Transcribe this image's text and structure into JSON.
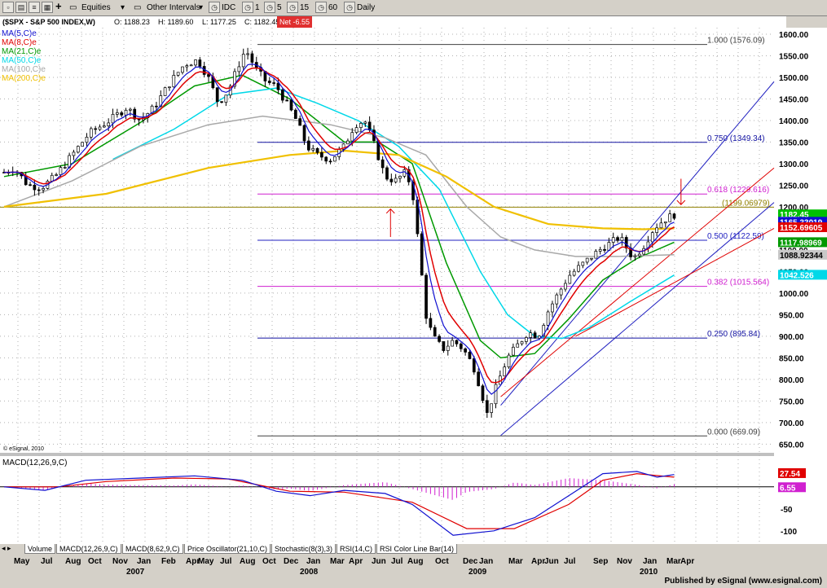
{
  "toolbar": {
    "symbol": "$SPX",
    "equities": "Equities",
    "other_intervals": "Other Intervals",
    "idc": "IDC",
    "intervals": [
      "1",
      "5",
      "15",
      "60",
      "Daily"
    ]
  },
  "chart_header": {
    "title": "($SPX - S&P 500 INDEX,W)",
    "open": "O: 1188.23",
    "high": "H: 1189.60",
    "low": "L: 1177.25",
    "close": "C: 1182.45",
    "net": "Net -6.55",
    "net_color": "#e03030"
  },
  "legend": [
    {
      "label": "MA(5,C)e",
      "color": "#1010d0"
    },
    {
      "label": "MA(8,C)e",
      "color": "#e00000"
    },
    {
      "label": "MA(21,C)e",
      "color": "#009900"
    },
    {
      "label": "MA(50,C)e",
      "color": "#00d8e8"
    },
    {
      "label": "MA(100,C)e",
      "color": "#a8a8a8"
    },
    {
      "label": "MA(200,C)e",
      "color": "#f0c000"
    }
  ],
  "copyright": "© eSignal, 2010",
  "fib_levels": [
    {
      "label": "1.000 (1576.09)",
      "value": 1576.09,
      "color": "#404040"
    },
    {
      "label": "0.750 (1349.34)",
      "value": 1349.34,
      "color": "#1010a0"
    },
    {
      "label": "0.618 (1229.616)",
      "value": 1229.616,
      "color": "#d020d0"
    },
    {
      "label": "(1199.06979)",
      "value": 1199.06979,
      "color": "#908000"
    },
    {
      "label": "0.500 (1122.59)",
      "value": 1122.59,
      "color": "#2020c0"
    },
    {
      "label": "0.382 (1015.564)",
      "value": 1015.564,
      "color": "#d020d0"
    },
    {
      "label": "0.250 (895.84)",
      "value": 895.84,
      "color": "#1010a0"
    },
    {
      "label": "0.000 (669.09)",
      "value": 669.09,
      "color": "#404040"
    }
  ],
  "price_tags": [
    {
      "label": "1182.45",
      "value": 1182.45,
      "bg": "#00c000",
      "fg": "#ffffff"
    },
    {
      "label": "1165.33019",
      "value": 1165.33019,
      "bg": "#1010d0",
      "fg": "#ffffff"
    },
    {
      "label": "1152.69605",
      "value": 1152.69605,
      "bg": "#e00000",
      "fg": "#ffffff"
    },
    {
      "label": "1117.98969",
      "value": 1117.98969,
      "bg": "#009900",
      "fg": "#ffffff"
    },
    {
      "label": "1088.92344",
      "value": 1088.92344,
      "bg": "#c8c8c8",
      "fg": "#000000"
    },
    {
      "label": "1042.526",
      "value": 1042.526,
      "bg": "#00d8e8",
      "fg": "#ffffff"
    }
  ],
  "macd_panel": {
    "title": "MACD(12,26,9,C)",
    "tags": [
      {
        "label": "27.54",
        "value": 27.54,
        "bg": "#e00000"
      },
      {
        "label": "6.55",
        "value": 6.55,
        "bg": "#d020d0"
      }
    ]
  },
  "tabs": [
    "Volume",
    "MACD(12,26,9,C)",
    "MACD(8,62,9,C)",
    "Price Oscillator(21,10,C)",
    "Stochastic(8(3),3)",
    "RSI(14,C)",
    "RSI Color Line Bar(14)"
  ],
  "footer": "Published by eSignal (www.esignal.com)",
  "chart_data": {
    "type": "candlestick",
    "title": "($SPX - S&P 500 INDEX,W)",
    "ylim": [
      630,
      1615
    ],
    "y_ticks": [
      650,
      700,
      750,
      800,
      850,
      900,
      950,
      1000,
      1050,
      1100,
      1150,
      1200,
      1250,
      1300,
      1350,
      1400,
      1450,
      1500,
      1550,
      1600
    ],
    "y_tick_labels": [
      "650.00",
      "700.00",
      "750.00",
      "800.00",
      "850.00",
      "900.00",
      "950.00",
      "1000.00",
      "1050.00",
      "1100.00",
      "1150.00",
      "1200.00",
      "1250.00",
      "1300.00",
      "1350.00",
      "1400.00",
      "1450.00",
      "1500.00",
      "1550.00",
      "1600.00"
    ],
    "x_months": [
      "May",
      "Jul",
      "Aug",
      "Oct",
      "Nov",
      "Jan",
      "Feb",
      "Apr",
      "May",
      "Jul",
      "Aug",
      "Oct",
      "Dec",
      "Jan",
      "Mar",
      "Apr",
      "Jun",
      "Jul",
      "Aug",
      "Oct",
      "Dec",
      "Jan",
      "Mar",
      "Apr",
      "Jun",
      "Jul",
      "Sep",
      "Nov",
      "Jan",
      "Mar",
      "Apr"
    ],
    "x_years": [
      "2007",
      "2008",
      "2009",
      "2010"
    ],
    "price_path": [
      {
        "t": 0,
        "v": 1280
      },
      {
        "t": 0.015,
        "v": 1290
      },
      {
        "t": 0.035,
        "v": 1250
      },
      {
        "t": 0.055,
        "v": 1245
      },
      {
        "t": 0.075,
        "v": 1270
      },
      {
        "t": 0.1,
        "v": 1320
      },
      {
        "t": 0.125,
        "v": 1370
      },
      {
        "t": 0.155,
        "v": 1400
      },
      {
        "t": 0.18,
        "v": 1430
      },
      {
        "t": 0.2,
        "v": 1400
      },
      {
        "t": 0.22,
        "v": 1430
      },
      {
        "t": 0.245,
        "v": 1490
      },
      {
        "t": 0.265,
        "v": 1530
      },
      {
        "t": 0.285,
        "v": 1540
      },
      {
        "t": 0.3,
        "v": 1500
      },
      {
        "t": 0.315,
        "v": 1440
      },
      {
        "t": 0.33,
        "v": 1470
      },
      {
        "t": 0.345,
        "v": 1530
      },
      {
        "t": 0.355,
        "v": 1565
      },
      {
        "t": 0.37,
        "v": 1520
      },
      {
        "t": 0.385,
        "v": 1490
      },
      {
        "t": 0.4,
        "v": 1480
      },
      {
        "t": 0.415,
        "v": 1440
      },
      {
        "t": 0.43,
        "v": 1400
      },
      {
        "t": 0.445,
        "v": 1340
      },
      {
        "t": 0.46,
        "v": 1320
      },
      {
        "t": 0.48,
        "v": 1310
      },
      {
        "t": 0.5,
        "v": 1340
      },
      {
        "t": 0.515,
        "v": 1390
      },
      {
        "t": 0.53,
        "v": 1400
      },
      {
        "t": 0.545,
        "v": 1340
      },
      {
        "t": 0.56,
        "v": 1270
      },
      {
        "t": 0.575,
        "v": 1260
      },
      {
        "t": 0.59,
        "v": 1280
      },
      {
        "t": 0.6,
        "v": 1240
      },
      {
        "t": 0.61,
        "v": 1100
      },
      {
        "t": 0.62,
        "v": 950
      },
      {
        "t": 0.63,
        "v": 900
      },
      {
        "t": 0.645,
        "v": 870
      },
      {
        "t": 0.66,
        "v": 890
      },
      {
        "t": 0.675,
        "v": 870
      },
      {
        "t": 0.69,
        "v": 830
      },
      {
        "t": 0.7,
        "v": 780
      },
      {
        "t": 0.71,
        "v": 720
      },
      {
        "t": 0.725,
        "v": 790
      },
      {
        "t": 0.74,
        "v": 850
      },
      {
        "t": 0.755,
        "v": 880
      },
      {
        "t": 0.77,
        "v": 910
      },
      {
        "t": 0.785,
        "v": 900
      },
      {
        "t": 0.8,
        "v": 960
      },
      {
        "t": 0.815,
        "v": 1000
      },
      {
        "t": 0.83,
        "v": 1040
      },
      {
        "t": 0.845,
        "v": 1060
      },
      {
        "t": 0.86,
        "v": 1080
      },
      {
        "t": 0.875,
        "v": 1100
      },
      {
        "t": 0.89,
        "v": 1115
      },
      {
        "t": 0.905,
        "v": 1130
      },
      {
        "t": 0.915,
        "v": 1105
      },
      {
        "t": 0.925,
        "v": 1080
      },
      {
        "t": 0.94,
        "v": 1110
      },
      {
        "t": 0.955,
        "v": 1150
      },
      {
        "t": 0.97,
        "v": 1170
      },
      {
        "t": 0.985,
        "v": 1182
      }
    ],
    "moving_averages": [
      {
        "name": "MA(21,C)e",
        "path": [
          {
            "t": 0,
            "v": 1270
          },
          {
            "t": 0.1,
            "v": 1300
          },
          {
            "t": 0.2,
            "v": 1395
          },
          {
            "t": 0.28,
            "v": 1480
          },
          {
            "t": 0.35,
            "v": 1505
          },
          {
            "t": 0.42,
            "v": 1450
          },
          {
            "t": 0.5,
            "v": 1350
          },
          {
            "t": 0.55,
            "v": 1350
          },
          {
            "t": 0.6,
            "v": 1300
          },
          {
            "t": 0.65,
            "v": 1070
          },
          {
            "t": 0.7,
            "v": 890
          },
          {
            "t": 0.73,
            "v": 850
          },
          {
            "t": 0.78,
            "v": 860
          },
          {
            "t": 0.83,
            "v": 940
          },
          {
            "t": 0.88,
            "v": 1030
          },
          {
            "t": 0.93,
            "v": 1080
          },
          {
            "t": 0.985,
            "v": 1118
          }
        ]
      },
      {
        "name": "MA(50,C)e",
        "path": [
          {
            "t": 0.16,
            "v": 1310
          },
          {
            "t": 0.25,
            "v": 1380
          },
          {
            "t": 0.33,
            "v": 1460
          },
          {
            "t": 0.4,
            "v": 1475
          },
          {
            "t": 0.46,
            "v": 1440
          },
          {
            "t": 0.52,
            "v": 1400
          },
          {
            "t": 0.58,
            "v": 1340
          },
          {
            "t": 0.64,
            "v": 1240
          },
          {
            "t": 0.7,
            "v": 1050
          },
          {
            "t": 0.74,
            "v": 950
          },
          {
            "t": 0.78,
            "v": 900
          },
          {
            "t": 0.82,
            "v": 895
          },
          {
            "t": 0.86,
            "v": 920
          },
          {
            "t": 0.92,
            "v": 980
          },
          {
            "t": 0.985,
            "v": 1042
          }
        ]
      },
      {
        "name": "MA(100,C)e",
        "path": [
          {
            "t": 0,
            "v": 1200
          },
          {
            "t": 0.1,
            "v": 1260
          },
          {
            "t": 0.2,
            "v": 1340
          },
          {
            "t": 0.3,
            "v": 1390
          },
          {
            "t": 0.38,
            "v": 1410
          },
          {
            "t": 0.48,
            "v": 1390
          },
          {
            "t": 0.56,
            "v": 1360
          },
          {
            "t": 0.62,
            "v": 1320
          },
          {
            "t": 0.68,
            "v": 1200
          },
          {
            "t": 0.73,
            "v": 1130
          },
          {
            "t": 0.78,
            "v": 1100
          },
          {
            "t": 0.84,
            "v": 1085
          },
          {
            "t": 0.9,
            "v": 1085
          },
          {
            "t": 0.985,
            "v": 1089
          }
        ]
      },
      {
        "name": "MA(200,C)e",
        "path": [
          {
            "t": 0,
            "v": 1200
          },
          {
            "t": 0.15,
            "v": 1230
          },
          {
            "t": 0.3,
            "v": 1290
          },
          {
            "t": 0.42,
            "v": 1320
          },
          {
            "t": 0.5,
            "v": 1330
          },
          {
            "t": 0.58,
            "v": 1320
          },
          {
            "t": 0.65,
            "v": 1270
          },
          {
            "t": 0.72,
            "v": 1200
          },
          {
            "t": 0.8,
            "v": 1160
          },
          {
            "t": 0.88,
            "v": 1150
          },
          {
            "t": 0.94,
            "v": 1148
          },
          {
            "t": 0.985,
            "v": 1150
          }
        ]
      }
    ],
    "macd": {
      "ylim": [
        -130,
        70
      ],
      "y_ticks": [
        -100,
        -50
      ],
      "y_tick_labels": [
        "-100",
        "-50"
      ],
      "macd_line": [
        {
          "t": 0,
          "v": 0
        },
        {
          "t": 0.06,
          "v": -8
        },
        {
          "t": 0.12,
          "v": 15
        },
        {
          "t": 0.2,
          "v": 20
        },
        {
          "t": 0.28,
          "v": 25
        },
        {
          "t": 0.35,
          "v": 15
        },
        {
          "t": 0.4,
          "v": -10
        },
        {
          "t": 0.45,
          "v": -20
        },
        {
          "t": 0.5,
          "v": -8
        },
        {
          "t": 0.56,
          "v": -15
        },
        {
          "t": 0.6,
          "v": -40
        },
        {
          "t": 0.66,
          "v": -110
        },
        {
          "t": 0.72,
          "v": -100
        },
        {
          "t": 0.78,
          "v": -70
        },
        {
          "t": 0.84,
          "v": -10
        },
        {
          "t": 0.88,
          "v": 30
        },
        {
          "t": 0.93,
          "v": 35
        },
        {
          "t": 0.96,
          "v": 22
        },
        {
          "t": 0.985,
          "v": 28
        }
      ],
      "signal_line": [
        {
          "t": 0,
          "v": 0
        },
        {
          "t": 0.08,
          "v": 0
        },
        {
          "t": 0.15,
          "v": 12
        },
        {
          "t": 0.25,
          "v": 20
        },
        {
          "t": 0.33,
          "v": 18
        },
        {
          "t": 0.42,
          "v": -10
        },
        {
          "t": 0.5,
          "v": -12
        },
        {
          "t": 0.6,
          "v": -35
        },
        {
          "t": 0.68,
          "v": -95
        },
        {
          "t": 0.75,
          "v": -95
        },
        {
          "t": 0.83,
          "v": -40
        },
        {
          "t": 0.88,
          "v": 15
        },
        {
          "t": 0.93,
          "v": 30
        },
        {
          "t": 0.985,
          "v": 22
        }
      ]
    }
  }
}
